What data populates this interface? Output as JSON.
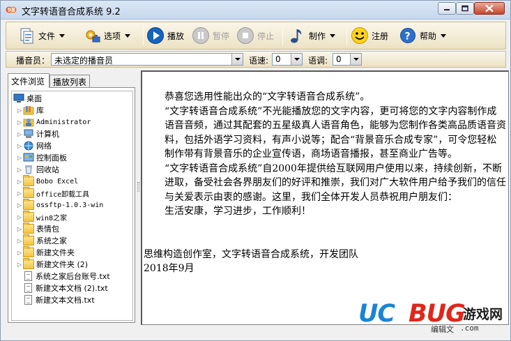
{
  "window": {
    "title": "文字转语音合成系统 9.2"
  },
  "toolbar": {
    "items": [
      {
        "label": "文件",
        "icon": "file-icon",
        "has_dropdown": true,
        "enabled": true
      },
      {
        "label": "选项",
        "icon": "options-icon",
        "has_dropdown": true,
        "enabled": true
      },
      {
        "label": "播放",
        "icon": "play-icon",
        "has_dropdown": false,
        "enabled": true
      },
      {
        "label": "暂停",
        "icon": "pause-icon",
        "has_dropdown": false,
        "enabled": false
      },
      {
        "label": "停止",
        "icon": "stop-icon",
        "has_dropdown": false,
        "enabled": false
      },
      {
        "label": "制作",
        "icon": "music-note-icon",
        "has_dropdown": true,
        "enabled": true
      },
      {
        "label": "注册",
        "icon": "smiley-icon",
        "has_dropdown": false,
        "enabled": true
      },
      {
        "label": "帮助",
        "icon": "help-icon",
        "has_dropdown": true,
        "enabled": true
      }
    ]
  },
  "options": {
    "announcer_label": "播音员：",
    "announcer_value": "未选定的播音员",
    "speed_label": "语速:",
    "speed_value": "0",
    "tone_label": "语调:",
    "tone_value": "0"
  },
  "left_panel": {
    "tabs": [
      "文件浏览",
      "播放列表"
    ],
    "active_tab": 0,
    "tree": [
      {
        "label": "桌面",
        "icon": "desktop-icon",
        "level": 0,
        "expandable": false
      },
      {
        "label": "库",
        "icon": "library-icon",
        "level": 1,
        "expandable": true
      },
      {
        "label": "Administrator",
        "icon": "user-icon",
        "level": 1,
        "expandable": true
      },
      {
        "label": "计算机",
        "icon": "computer-icon",
        "level": 1,
        "expandable": true
      },
      {
        "label": "网络",
        "icon": "network-icon",
        "level": 1,
        "expandable": true
      },
      {
        "label": "控制面板",
        "icon": "control-panel-icon",
        "level": 1,
        "expandable": true
      },
      {
        "label": "回收站",
        "icon": "recycle-bin-icon",
        "level": 1,
        "expandable": true
      },
      {
        "label": "Bobo Excel",
        "icon": "folder-icon",
        "level": 1,
        "expandable": true
      },
      {
        "label": "office卸载工具",
        "icon": "folder-icon",
        "level": 1,
        "expandable": true
      },
      {
        "label": "ossftp-1.0.3-win",
        "icon": "folder-icon",
        "level": 1,
        "expandable": true
      },
      {
        "label": "win8之家",
        "icon": "folder-icon",
        "level": 1,
        "expandable": true
      },
      {
        "label": "表情包",
        "icon": "folder-icon",
        "level": 1,
        "expandable": true
      },
      {
        "label": "系统之家",
        "icon": "folder-icon",
        "level": 1,
        "expandable": true
      },
      {
        "label": "新建文件夹",
        "icon": "folder-icon",
        "level": 1,
        "expandable": true
      },
      {
        "label": "新建文件夹 (2)",
        "icon": "folder-icon",
        "level": 1,
        "expandable": true
      },
      {
        "label": "系统之家后台账号.txt",
        "icon": "text-file-icon",
        "level": 1,
        "expandable": false
      },
      {
        "label": "新建文本文档 (2).txt",
        "icon": "text-file-icon",
        "level": 1,
        "expandable": false
      },
      {
        "label": "新建文本文档.txt",
        "icon": "text-file-icon",
        "level": 1,
        "expandable": false
      }
    ]
  },
  "editor": {
    "paragraphs": [
      {
        "text": "恭喜您选用性能出众的“文字转语音合成系统”。",
        "indent": true
      },
      {
        "text": "“文字转语音合成系统”不光能播放您的文字内容，更可将您的文字内容制作成语音音频，通过其配套的五星级真人语音角色，能够为您制作各类高品质语音资料，包括外语学习资料，有声小说等；配合“背景音乐合成专家”，可令您轻松制作带有背景音乐的企业宣传语，商场语音播报，甚至商业广告等。",
        "indent": true
      },
      {
        "text": "“文字转语音合成系统”自2000年提供给互联网用户使用以来，持续创新，不断进取，备受社会各界朋友们的好评和推崇，我们对广大软件用户给予我们的信任与关爱表示由衷的感谢。这里，我们全体开发人员恭祝用户朋友们：",
        "indent": true
      },
      {
        "text": "生活安康，学习进步，工作顺利！",
        "indent": true
      },
      {
        "text": "",
        "indent": false
      },
      {
        "text": "思维构造创作室，文字转语音合成系统，开发团队",
        "indent": false
      },
      {
        "text": "2018年9月",
        "indent": false
      }
    ]
  },
  "watermark": {
    "brand_uc": "UC",
    "brand_bug": "BUG",
    "brand_cn": "游戏网",
    "sub": "编辑文",
    "url": ".com"
  },
  "colors": {
    "toolbar_bg": "#ece2c4",
    "play_blue": "#1565c0",
    "watermark_blue": "#1a84d6",
    "watermark_red": "#e0261b"
  }
}
